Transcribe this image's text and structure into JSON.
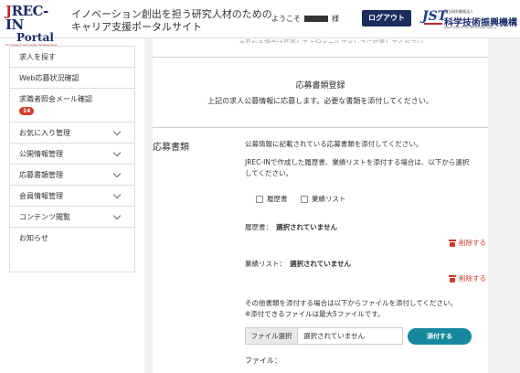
{
  "header": {
    "logo_line1_j": "J",
    "logo_line1_rest": "REC-IN",
    "logo_line2": "Portal",
    "logo_tagline": "for research and career development",
    "site_title_line1": "イノベーション創出を担う研究人材のための",
    "site_title_line2": "キャリア支援ポータルサイト",
    "greeting_prefix": "ようこそ",
    "greeting_suffix": "様",
    "logout_label": "ログアウト",
    "jst_mark": "JST",
    "jst_sub": "国立研究開発法人",
    "jst_name": "科学技術振興機構",
    "jst_en": "Japan Science and Technology Agency"
  },
  "sidebar": {
    "items": [
      {
        "label": "求人を探す",
        "has_chevron": false
      },
      {
        "label": "Web応募状況確認",
        "has_chevron": false
      },
      {
        "label": "求職者照会メール確認",
        "badge": "14",
        "has_chevron": false
      },
      {
        "label": "お気に入り管理",
        "has_chevron": true
      },
      {
        "label": "公開情報管理",
        "has_chevron": true
      },
      {
        "label": "応募書類管理",
        "has_chevron": true
      },
      {
        "label": "会員情報管理",
        "has_chevron": true
      },
      {
        "label": "コンテンツ閲覧",
        "has_chevron": true
      },
      {
        "label": "お知らせ",
        "has_chevron": false
      }
    ]
  },
  "main": {
    "top_note": "※変わる場合は変更して上記メールアドレスに応募してください。",
    "section_title": "応募書類登録",
    "section_subtitle": "上記の求人公募情報に応募します。必要な書類を添付してください。",
    "field_label": "応募書類",
    "instruction_1": "公募情報に記載されている応募書類を添付してください。",
    "instruction_2_line1": "JREC-INで作成した履歴書、業績リストを添付する場合は、以下から選択",
    "instruction_2_line2": "してください。",
    "checkbox_resume": "履歴書",
    "checkbox_achievements": "業績リスト",
    "resume_label": "履歴書：",
    "resume_value": "選択されていません",
    "achievements_label": "業績リスト：",
    "achievements_value": "選択されていません",
    "delete_label": "削除する",
    "other_docs_line1": "その他書類を添付する場合は以下からファイルを添付してください。",
    "other_docs_line2": "※添付できるファイルは最大5ファイルです。",
    "file_select_label": "ファイル選択",
    "file_input_value": "選択されていません",
    "attach_label": "添付する",
    "file_label": "ファイル："
  },
  "colors": {
    "navy": "#1c2c5e",
    "delete_red": "#d63a2b",
    "attach_teal": "#17889e",
    "badge_red": "#d63a2b"
  }
}
